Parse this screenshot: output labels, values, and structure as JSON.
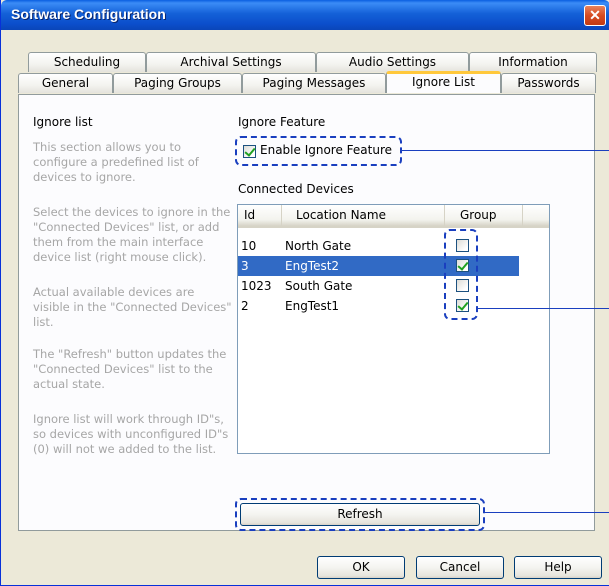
{
  "window": {
    "title": "Software Configuration",
    "close_glyph": "✕"
  },
  "tabs": {
    "row1": [
      "Scheduling",
      "Archival Settings",
      "Audio Settings",
      "Information"
    ],
    "row2": [
      "General",
      "Paging Groups",
      "Paging Messages",
      "Ignore List",
      "Passwords"
    ],
    "active": "Ignore List"
  },
  "left": {
    "heading": "Ignore list",
    "paragraphs": [
      "This section allows you to configure a predefined list of devices to ignore.",
      "Select the devices to ignore in the \"Connected Devices\" list, or add them from the main interface device list (right mouse click).",
      "Actual available devices are visible in the \"Connected Devices\" list.",
      "The \"Refresh\" button updates the \"Connected Devices\" list to the actual state.",
      "Ignore list will work through ID\"s, so devices with unconfigured ID\"s (0) will not we added to the list."
    ]
  },
  "feature": {
    "heading": "Ignore Feature",
    "enable_label": "Enable Ignore Feature",
    "enable_checked": true
  },
  "devices": {
    "heading": "Connected Devices",
    "columns": [
      "Id",
      "Location Name",
      "Group"
    ],
    "rows": [
      {
        "id": "10",
        "name": "North Gate",
        "group": false,
        "selected": false
      },
      {
        "id": "3",
        "name": "EngTest2",
        "group": true,
        "selected": true
      },
      {
        "id": "1023",
        "name": "South Gate",
        "group": false,
        "selected": false
      },
      {
        "id": "2",
        "name": "EngTest1",
        "group": true,
        "selected": false
      }
    ]
  },
  "buttons": {
    "refresh": "Refresh",
    "ok": "OK",
    "cancel": "Cancel",
    "help": "Help"
  },
  "colors": {
    "title_bar": "#0b4ecb",
    "selection": "#316ac5",
    "active_tab_accent": "#ffc83c",
    "callout": "#1a3fbf"
  }
}
